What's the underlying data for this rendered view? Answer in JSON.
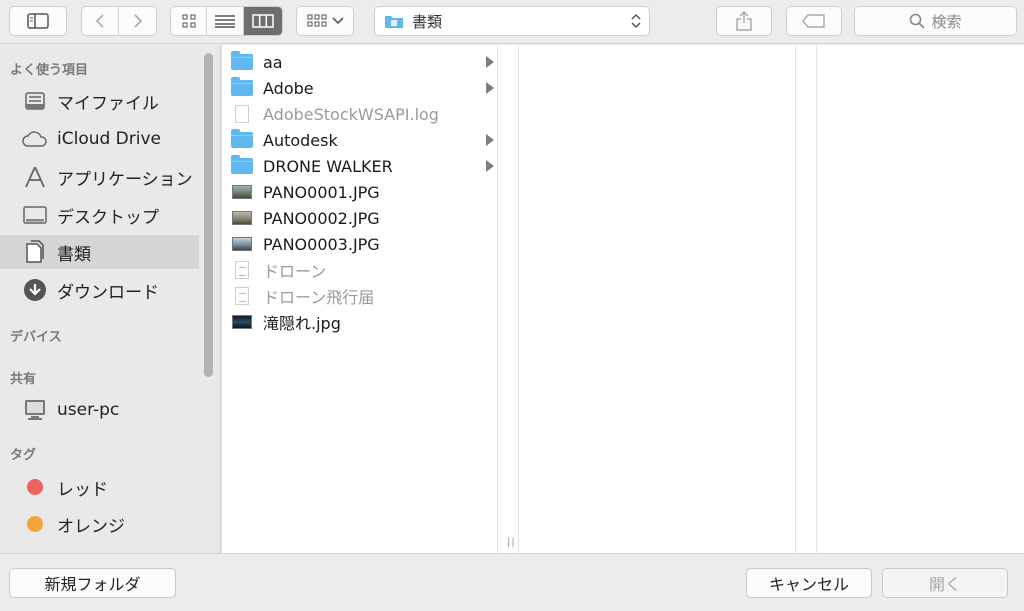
{
  "toolbar": {
    "path_label": "書類",
    "search_placeholder": "検索"
  },
  "sidebar": {
    "sections": {
      "favorites": "よく使う項目",
      "devices": "デバイス",
      "shared": "共有",
      "tags": "タグ"
    },
    "favorites": [
      {
        "label": "マイファイル",
        "icon": "all-my-files-icon"
      },
      {
        "label": "iCloud Drive",
        "icon": "cloud-icon"
      },
      {
        "label": "アプリケーション",
        "icon": "applications-icon"
      },
      {
        "label": "デスクトップ",
        "icon": "desktop-icon"
      },
      {
        "label": "書類",
        "icon": "documents-icon",
        "selected": true
      },
      {
        "label": "ダウンロード",
        "icon": "downloads-icon"
      }
    ],
    "shared": [
      {
        "label": "user-pc",
        "icon": "pc-icon"
      }
    ],
    "tags": [
      {
        "label": "レッド",
        "color": "#f0625e"
      },
      {
        "label": "オレンジ",
        "color": "#f7a33c"
      }
    ]
  },
  "files": [
    {
      "name": "aa",
      "type": "folder",
      "has_children": true
    },
    {
      "name": "Adobe",
      "type": "folder",
      "has_children": true
    },
    {
      "name": "AdobeStockWSAPI.log",
      "type": "doc",
      "dim": true
    },
    {
      "name": "Autodesk",
      "type": "folder",
      "has_children": true
    },
    {
      "name": "DRONE WALKER",
      "type": "folder",
      "has_children": true
    },
    {
      "name": "PANO0001.JPG",
      "type": "image"
    },
    {
      "name": "PANO0002.JPG",
      "type": "image"
    },
    {
      "name": "PANO0003.JPG",
      "type": "image"
    },
    {
      "name": "ドローン",
      "type": "doc",
      "dim": true
    },
    {
      "name": "ドローン飛行届",
      "type": "doc",
      "dim": true
    },
    {
      "name": "滝隠れ.jpg",
      "type": "image"
    }
  ],
  "bottom": {
    "new_folder": "新規フォルダ",
    "cancel": "キャンセル",
    "open": "開く"
  },
  "colors": {
    "folder": "#5fb8ef",
    "selected_sidebar": "#d6d6d6"
  }
}
